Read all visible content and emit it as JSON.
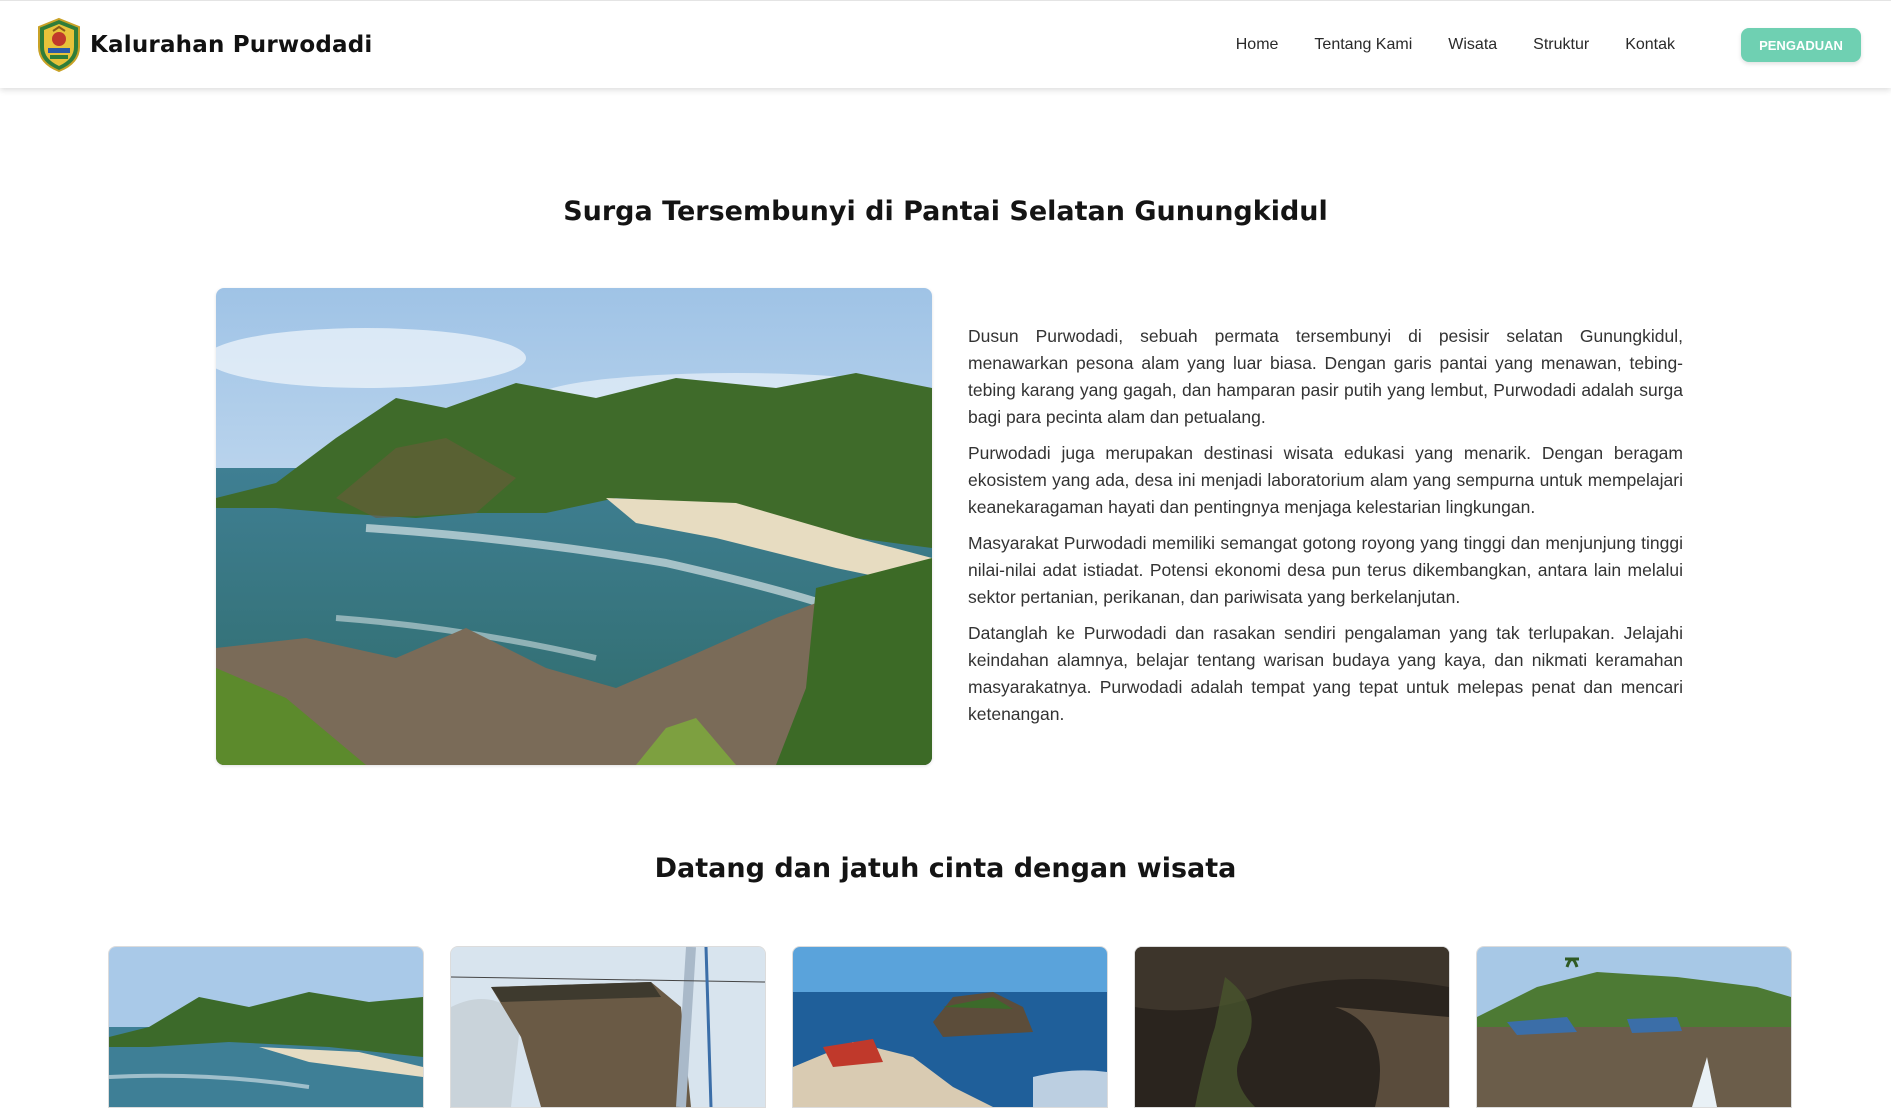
{
  "brand": {
    "name": "Kalurahan Purwodadi",
    "logo_icon": "regency-crest-logo"
  },
  "nav": {
    "items": [
      "Home",
      "Tentang Kami",
      "Wisata",
      "Struktur",
      "Kontak"
    ],
    "cta_label": "PENGADUAN"
  },
  "about": {
    "title": "Surga Tersembunyi di Pantai Selatan Gunungkidul",
    "paragraphs": [
      "Dusun Purwodadi, sebuah permata tersembunyi di pesisir selatan Gunungkidul, menawarkan pesona alam yang luar biasa. Dengan garis pantai yang menawan, tebing-tebing karang yang gagah, dan hamparan pasir putih yang lembut, Purwodadi adalah surga bagi para pecinta alam dan petualang.",
      "Purwodadi juga merupakan destinasi wisata edukasi yang menarik. Dengan beragam ekosistem yang ada, desa ini menjadi laboratorium alam yang sempurna untuk mempelajari keanekaragaman hayati dan pentingnya menjaga kelestarian lingkungan.",
      "Masyarakat Purwodadi memiliki semangat gotong royong yang tinggi dan menjunjung tinggi nilai-nilai adat istiadat. Potensi ekonomi desa pun terus dikembangkan, antara lain melalui sektor pertanian, perikanan, dan pariwisata yang berkelanjutan.",
      "Datanglah ke Purwodadi dan rasakan sendiri pengalaman yang tak terlupakan. Jelajahi keindahan alamnya, belajar tentang warisan budaya yang kaya, dan nikmati keramahan masyarakatnya. Purwodadi adalah tempat yang tepat untuk melepas penat dan mencari ketenangan."
    ]
  },
  "tourism": {
    "title": "Datang dan jatuh cinta dengan wisata"
  },
  "colors": {
    "accent": "#6fd0b2",
    "text": "#333333",
    "heading": "#141414"
  }
}
